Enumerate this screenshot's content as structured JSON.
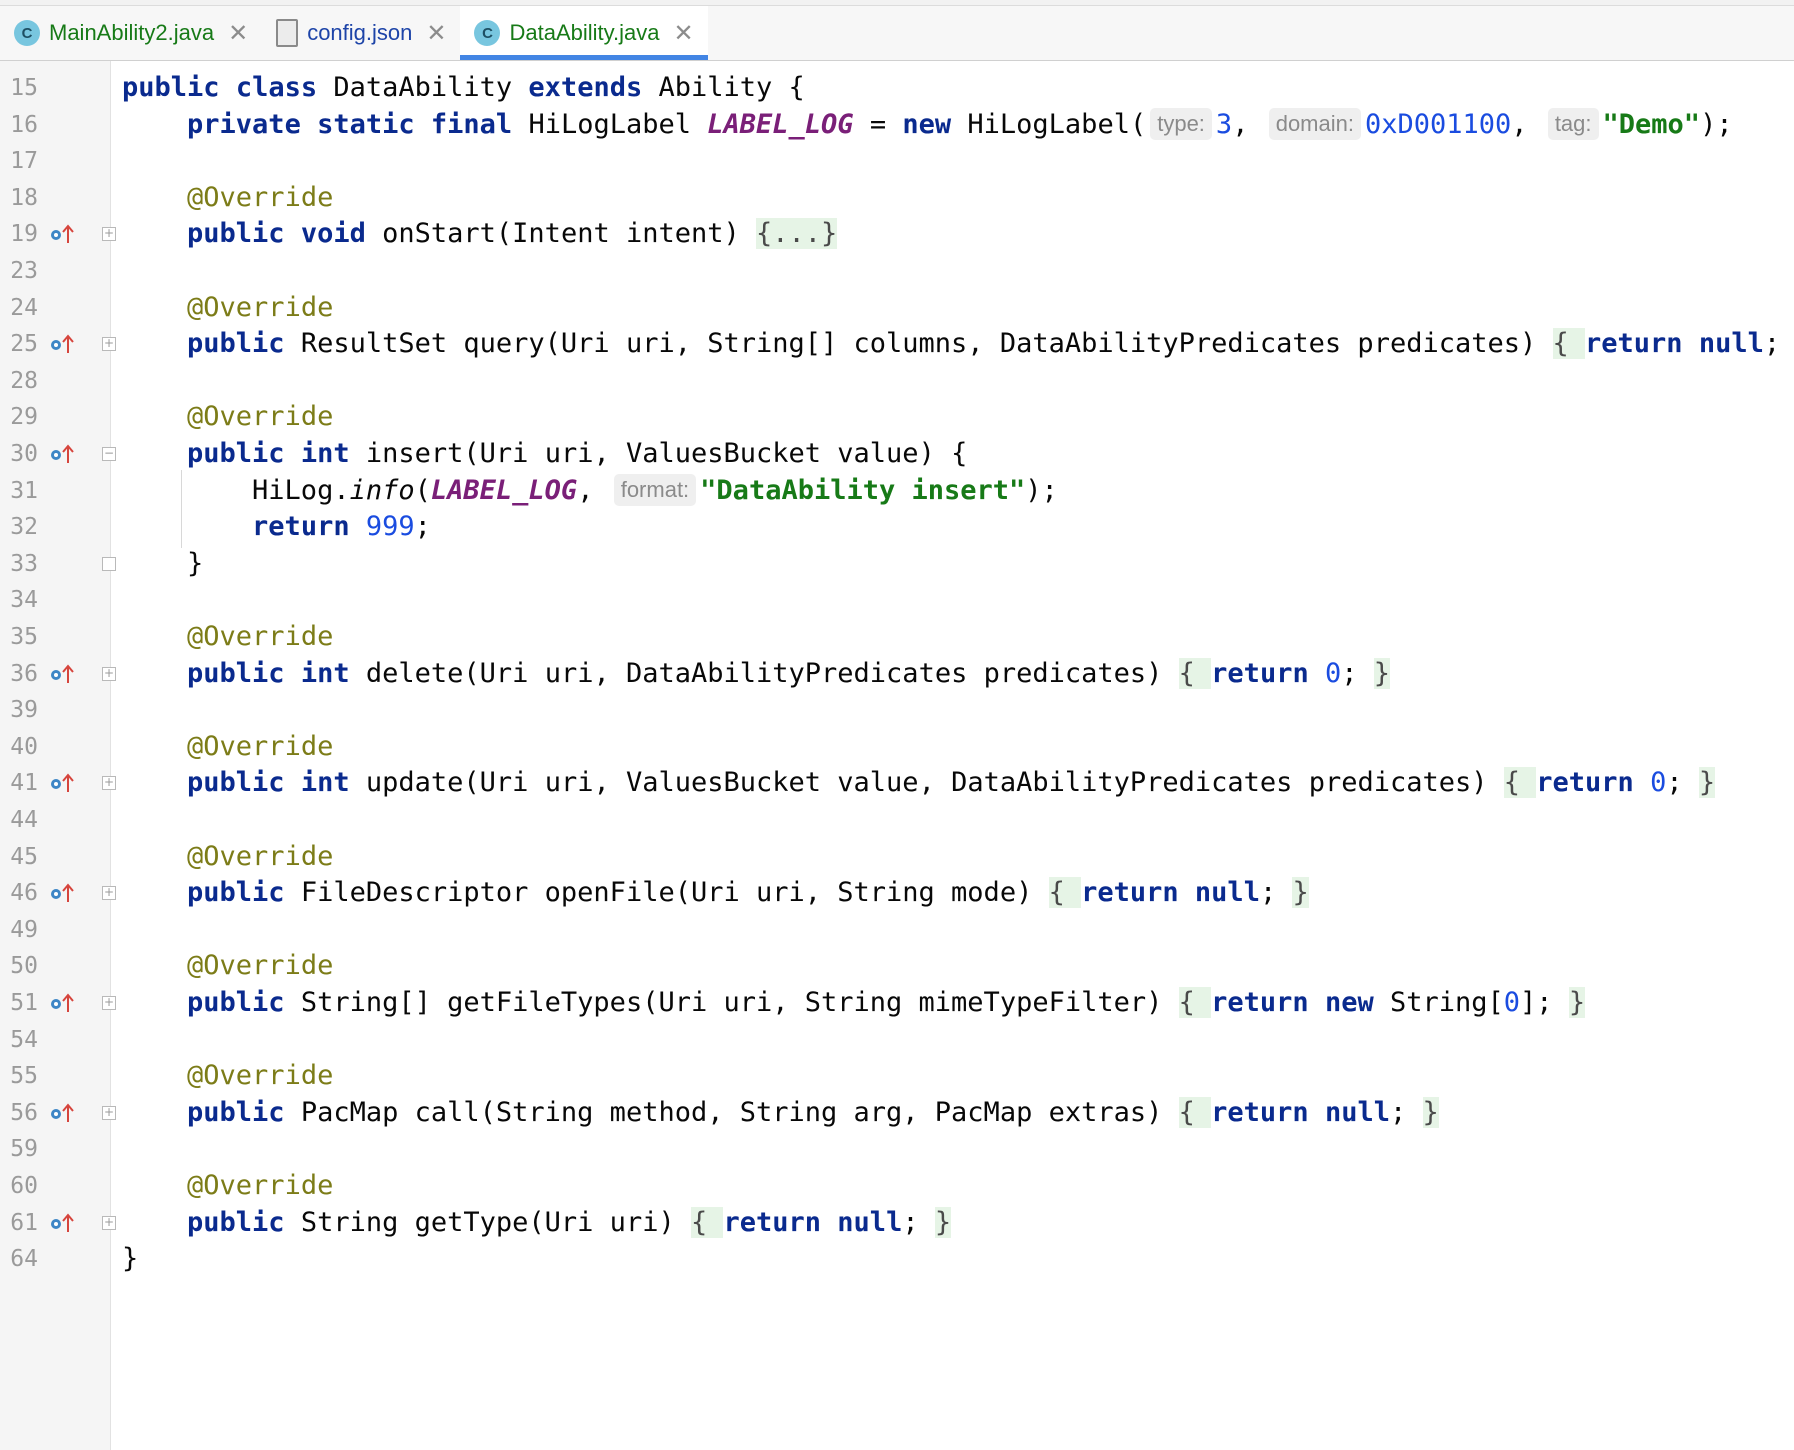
{
  "tabs": [
    {
      "label": "MainAbility2.java",
      "icon": "java-class-icon",
      "active": false
    },
    {
      "label": "config.json",
      "icon": "json-file-icon",
      "active": false
    },
    {
      "label": "DataAbility.java",
      "icon": "java-class-icon",
      "active": true
    }
  ],
  "tab_icon_letter": "C",
  "tab_close_glyph": "✕",
  "colors": {
    "keyword": "#0a2a8e",
    "annotation": "#7c7c18",
    "string": "#177a17",
    "number": "#1a4ce0",
    "constant": "#7a1f78",
    "active_tab_underline": "#4285e4"
  },
  "lines": [
    {
      "n": "15",
      "tokens": [
        [
          "kw",
          "public"
        ],
        [
          "t",
          " "
        ],
        [
          "kw",
          "class"
        ],
        [
          "t",
          " DataAbility "
        ],
        [
          "kw",
          "extends"
        ],
        [
          "t",
          " Ability {"
        ]
      ]
    },
    {
      "n": "16",
      "tokens": [
        [
          "t",
          "    "
        ],
        [
          "kw",
          "private"
        ],
        [
          "t",
          " "
        ],
        [
          "kw",
          "static"
        ],
        [
          "t",
          " "
        ],
        [
          "kw",
          "final"
        ],
        [
          "t",
          " HiLogLabel "
        ],
        [
          "const",
          "LABEL_LOG"
        ],
        [
          "t",
          " = "
        ],
        [
          "kw",
          "new"
        ],
        [
          "t",
          " HiLogLabel("
        ],
        [
          "hint",
          "type:"
        ],
        [
          "num",
          "3"
        ],
        [
          "t",
          ", "
        ],
        [
          "hint",
          "domain:"
        ],
        [
          "num",
          "0xD001100"
        ],
        [
          "t",
          ", "
        ],
        [
          "hint",
          "tag:"
        ],
        [
          "str",
          "\"Demo\""
        ],
        [
          "t",
          ");"
        ]
      ]
    },
    {
      "n": "17",
      "tokens": []
    },
    {
      "n": "18",
      "tokens": [
        [
          "t",
          "    "
        ],
        [
          "ann",
          "@Override"
        ]
      ]
    },
    {
      "n": "19",
      "marker": true,
      "fold": "+",
      "tokens": [
        [
          "t",
          "    "
        ],
        [
          "kw",
          "public"
        ],
        [
          "t",
          " "
        ],
        [
          "kw",
          "void"
        ],
        [
          "t",
          " onStart(Intent intent) "
        ],
        [
          "fb",
          "{...}"
        ]
      ]
    },
    {
      "n": "23",
      "tokens": []
    },
    {
      "n": "24",
      "tokens": [
        [
          "t",
          "    "
        ],
        [
          "ann",
          "@Override"
        ]
      ]
    },
    {
      "n": "25",
      "marker": true,
      "fold": "+",
      "tokens": [
        [
          "t",
          "    "
        ],
        [
          "kw",
          "public"
        ],
        [
          "t",
          " ResultSet query(Uri uri, String[] columns, DataAbilityPredicates predicates) "
        ],
        [
          "fb",
          "{ "
        ],
        [
          "kw",
          "return"
        ],
        [
          "t",
          " "
        ],
        [
          "kw",
          "null"
        ],
        [
          "t",
          "; "
        ],
        [
          "fb",
          "}"
        ]
      ]
    },
    {
      "n": "28",
      "tokens": []
    },
    {
      "n": "29",
      "tokens": [
        [
          "t",
          "    "
        ],
        [
          "ann",
          "@Override"
        ]
      ]
    },
    {
      "n": "30",
      "marker": true,
      "fold": "-",
      "tokens": [
        [
          "t",
          "    "
        ],
        [
          "kw",
          "public"
        ],
        [
          "t",
          " "
        ],
        [
          "kw",
          "int"
        ],
        [
          "t",
          " insert(Uri uri, ValuesBucket value) {"
        ]
      ]
    },
    {
      "n": "31",
      "guide": true,
      "tokens": [
        [
          "t",
          "        HiLog."
        ],
        [
          "ital",
          "info"
        ],
        [
          "t",
          "("
        ],
        [
          "const",
          "LABEL_LOG"
        ],
        [
          "t",
          ", "
        ],
        [
          "hint",
          "format:"
        ],
        [
          "str",
          "\"DataAbility insert\""
        ],
        [
          "t",
          ");"
        ]
      ]
    },
    {
      "n": "32",
      "guide": true,
      "tokens": [
        [
          "t",
          "        "
        ],
        [
          "kw",
          "return"
        ],
        [
          "t",
          " "
        ],
        [
          "num",
          "999"
        ],
        [
          "t",
          ";"
        ]
      ]
    },
    {
      "n": "33",
      "fold": "end",
      "tokens": [
        [
          "t",
          "    }"
        ]
      ]
    },
    {
      "n": "34",
      "tokens": []
    },
    {
      "n": "35",
      "tokens": [
        [
          "t",
          "    "
        ],
        [
          "ann",
          "@Override"
        ]
      ]
    },
    {
      "n": "36",
      "marker": true,
      "fold": "+",
      "tokens": [
        [
          "t",
          "    "
        ],
        [
          "kw",
          "public"
        ],
        [
          "t",
          " "
        ],
        [
          "kw",
          "int"
        ],
        [
          "t",
          " delete(Uri uri, DataAbilityPredicates predicates) "
        ],
        [
          "fb",
          "{ "
        ],
        [
          "kw",
          "return"
        ],
        [
          "t",
          " "
        ],
        [
          "num",
          "0"
        ],
        [
          "t",
          "; "
        ],
        [
          "fb",
          "}"
        ]
      ]
    },
    {
      "n": "39",
      "tokens": []
    },
    {
      "n": "40",
      "tokens": [
        [
          "t",
          "    "
        ],
        [
          "ann",
          "@Override"
        ]
      ]
    },
    {
      "n": "41",
      "marker": true,
      "fold": "+",
      "tokens": [
        [
          "t",
          "    "
        ],
        [
          "kw",
          "public"
        ],
        [
          "t",
          " "
        ],
        [
          "kw",
          "int"
        ],
        [
          "t",
          " update(Uri uri, ValuesBucket value, DataAbilityPredicates predicates) "
        ],
        [
          "fb",
          "{ "
        ],
        [
          "kw",
          "return"
        ],
        [
          "t",
          " "
        ],
        [
          "num",
          "0"
        ],
        [
          "t",
          "; "
        ],
        [
          "fb",
          "}"
        ]
      ]
    },
    {
      "n": "44",
      "tokens": []
    },
    {
      "n": "45",
      "tokens": [
        [
          "t",
          "    "
        ],
        [
          "ann",
          "@Override"
        ]
      ]
    },
    {
      "n": "46",
      "marker": true,
      "fold": "+",
      "tokens": [
        [
          "t",
          "    "
        ],
        [
          "kw",
          "public"
        ],
        [
          "t",
          " FileDescriptor openFile(Uri uri, String mode) "
        ],
        [
          "fb",
          "{ "
        ],
        [
          "kw",
          "return"
        ],
        [
          "t",
          " "
        ],
        [
          "kw",
          "null"
        ],
        [
          "t",
          "; "
        ],
        [
          "fb",
          "}"
        ]
      ]
    },
    {
      "n": "49",
      "tokens": []
    },
    {
      "n": "50",
      "tokens": [
        [
          "t",
          "    "
        ],
        [
          "ann",
          "@Override"
        ]
      ]
    },
    {
      "n": "51",
      "marker": true,
      "fold": "+",
      "tokens": [
        [
          "t",
          "    "
        ],
        [
          "kw",
          "public"
        ],
        [
          "t",
          " String[] getFileTypes(Uri uri, String mimeTypeFilter) "
        ],
        [
          "fb",
          "{ "
        ],
        [
          "kw",
          "return"
        ],
        [
          "t",
          " "
        ],
        [
          "kw",
          "new"
        ],
        [
          "t",
          " String["
        ],
        [
          "num",
          "0"
        ],
        [
          "t",
          "]; "
        ],
        [
          "fb",
          "}"
        ]
      ]
    },
    {
      "n": "54",
      "tokens": []
    },
    {
      "n": "55",
      "tokens": [
        [
          "t",
          "    "
        ],
        [
          "ann",
          "@Override"
        ]
      ]
    },
    {
      "n": "56",
      "marker": true,
      "fold": "+",
      "tokens": [
        [
          "t",
          "    "
        ],
        [
          "kw",
          "public"
        ],
        [
          "t",
          " PacMap call(String method, String arg, PacMap extras) "
        ],
        [
          "fb",
          "{ "
        ],
        [
          "kw",
          "return"
        ],
        [
          "t",
          " "
        ],
        [
          "kw",
          "null"
        ],
        [
          "t",
          "; "
        ],
        [
          "fb",
          "}"
        ]
      ]
    },
    {
      "n": "59",
      "tokens": []
    },
    {
      "n": "60",
      "tokens": [
        [
          "t",
          "    "
        ],
        [
          "ann",
          "@Override"
        ]
      ]
    },
    {
      "n": "61",
      "marker": true,
      "fold": "+",
      "tokens": [
        [
          "t",
          "    "
        ],
        [
          "kw",
          "public"
        ],
        [
          "t",
          " String getType(Uri uri) "
        ],
        [
          "fb",
          "{ "
        ],
        [
          "kw",
          "return"
        ],
        [
          "t",
          " "
        ],
        [
          "kw",
          "null"
        ],
        [
          "t",
          "; "
        ],
        [
          "fb",
          "}"
        ]
      ]
    },
    {
      "n": "64",
      "tokens": [
        [
          "t",
          "}"
        ]
      ]
    }
  ]
}
